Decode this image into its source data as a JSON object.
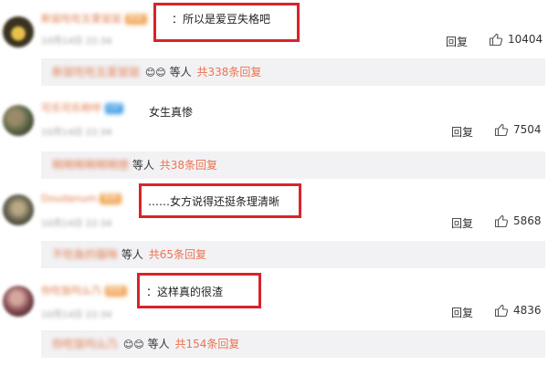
{
  "comments": [
    {
      "username": "新鼠吃吃五爱鼠鼠",
      "badge": "铁粉",
      "timestamp": "10月14日 22:34",
      "text": "：所以是爱豆失格吧",
      "reply_label": "回复",
      "likes": "10404",
      "sub": {
        "name": "新鼠吃吃五爱鼠鼠",
        "others": "等人",
        "total": "共338条回复"
      }
    },
    {
      "username": "可乐可乐称呼",
      "badge": "VIP",
      "timestamp": "10月14日 22:34",
      "text": "女生真惨",
      "reply_label": "回复",
      "likes": "7504",
      "sub": {
        "name": "啊啊啊啊啊啊想",
        "others": "等人",
        "total": "共38条回复"
      }
    },
    {
      "username": "Doudanum",
      "badge": "铁粉",
      "timestamp": "10月14日 22:34",
      "text": "……女方说得还挺条理清晰",
      "reply_label": "回复",
      "likes": "5868",
      "sub": {
        "name": "不吃鱼的猫咪",
        "others": "等人",
        "total": "共65条回复"
      }
    },
    {
      "username": "你吃饭吗么乃",
      "badge": "铁粉",
      "timestamp": "10月14日 22:34",
      "text": "：这样真的很渣",
      "reply_label": "回复",
      "likes": "4836",
      "sub": {
        "name": "你吃饭吗么乃",
        "others": "等人",
        "total": "共154条回复"
      }
    }
  ],
  "colors": {
    "highlight_border": "#d9232b",
    "username": "#e07a4a",
    "reply_link": "#eb7350",
    "subrow_bg": "#f2f2f5"
  },
  "icons": {
    "like": "thumbs-up-icon"
  }
}
